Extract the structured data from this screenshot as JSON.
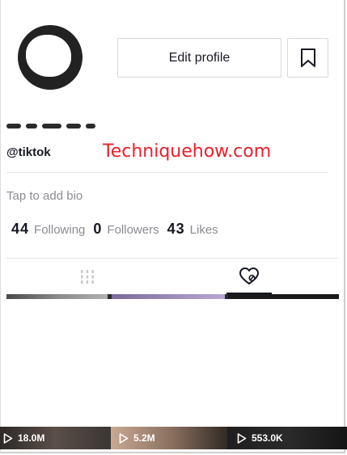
{
  "profile": {
    "username": "@tiktok",
    "edit_label": "Edit profile",
    "bio_placeholder": "Tap to add bio"
  },
  "stats": {
    "following_count": "44",
    "following_label": "Following",
    "followers_count": "0",
    "followers_label": "Followers",
    "likes_count": "43",
    "likes_label": "Likes"
  },
  "watermark": "Techniquehow.com",
  "tabs": {
    "videos_icon": "grid-icon",
    "liked_icon": "liked-heart-icon"
  },
  "videos": [
    {
      "views": "18.0M"
    },
    {
      "views": "5.2M"
    },
    {
      "views": "553.0K"
    }
  ],
  "colors": {
    "watermark": "#e8202b",
    "text": "#161823",
    "muted": "#8a8b91"
  }
}
